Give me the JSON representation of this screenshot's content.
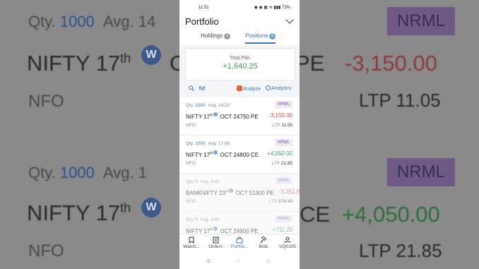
{
  "background": {
    "qty_label": "Qty.",
    "qty_value": "1000",
    "avg_label": "Avg. 14",
    "nrml": "NRML",
    "row1_name": "NIFTY 17",
    "row1_sup": "th",
    "row1_mid": "OCT",
    "row1_suffix": "PE",
    "row1_pnl": "-3,150.00",
    "exch": "NFO",
    "row1_ltp": "LTP 11.05",
    "row2_qty_label": "Qty.",
    "row2_qty_value": "1000",
    "row2_avg_label": "Avg. 1",
    "row2_nrml": "NRML",
    "row2_name": "NIFTY 17",
    "row2_sup": "th",
    "row2_suffix": "CE",
    "row2_pnl": "+4,050.00",
    "row2_exch": "NFO",
    "row2_ltp": "LTP 21.85",
    "w_badge": "W"
  },
  "status_bar": {
    "time": "11:51",
    "indicators": "◉ ◉ ▦ ≋ ▮▮▮ 73%"
  },
  "header": {
    "title": "Portfolio",
    "tabs": [
      {
        "label": "Holdings",
        "count": "1"
      },
      {
        "label": "Positions",
        "count": "5"
      }
    ]
  },
  "summary": {
    "label": "Total P&L",
    "value": "+1,640.25"
  },
  "toolbar": {
    "analyze": "Analyze",
    "analytics": "Analytics"
  },
  "positions": [
    {
      "qty_label": "Qty.",
      "qty": "1000",
      "avg": "Avg. 14.20",
      "product": "NRML",
      "name": "NIFTY 17",
      "sup": "th",
      "rest": "OCT 24750 PE",
      "pnl": "-3,150.00",
      "pnl_type": "red",
      "exch": "NFO",
      "ltp_label": "LTP",
      "ltp": "11.05",
      "faded": false
    },
    {
      "qty_label": "Qty.",
      "qty": "1000",
      "avg": "Avg. 17.80",
      "product": "NRML",
      "name": "NIFTY 17",
      "sup": "th",
      "rest": "OCT 24800 CE",
      "pnl": "+4,050.00",
      "pnl_type": "green",
      "exch": "NFO",
      "ltp_label": "LTP",
      "ltp": "21.85",
      "faded": false
    },
    {
      "qty_label": "Qty.",
      "qty": "0",
      "avg": "Avg. 0.00",
      "product": "NRML",
      "name": "BANKNIFTY 23",
      "sup": "rd",
      "rest": "OCT 51300 PE",
      "pnl": "-3,351.0",
      "pnl_type": "red",
      "exch": "NFO",
      "ltp_label": "LTP",
      "ltp": "376.40",
      "faded": true
    },
    {
      "qty_label": "Qty.",
      "qty": "0",
      "avg": "Avg. 0.00",
      "product": "NRML",
      "name": "NIFTY 17",
      "sup": "th",
      "rest": "OCT 24900 PE",
      "pnl": "+711.25",
      "pnl_type": "green",
      "exch": "NFO",
      "ltp_label": "",
      "ltp": "",
      "faded": true
    }
  ],
  "bottom_nav": [
    {
      "label": "Watch...",
      "icon": "bookmark-icon"
    },
    {
      "label": "Orders",
      "icon": "orders-icon"
    },
    {
      "label": "Portfol...",
      "icon": "portfolio-icon",
      "active": true
    },
    {
      "label": "Bids",
      "icon": "gavel-icon"
    },
    {
      "label": "VQ0105",
      "icon": "user-icon"
    }
  ],
  "colors": {
    "accent": "#3b78c9",
    "profit": "#3aa55a",
    "loss": "#e24b4b",
    "product_badge": "#7b57a8",
    "analyze_icon": "#f0652a"
  }
}
